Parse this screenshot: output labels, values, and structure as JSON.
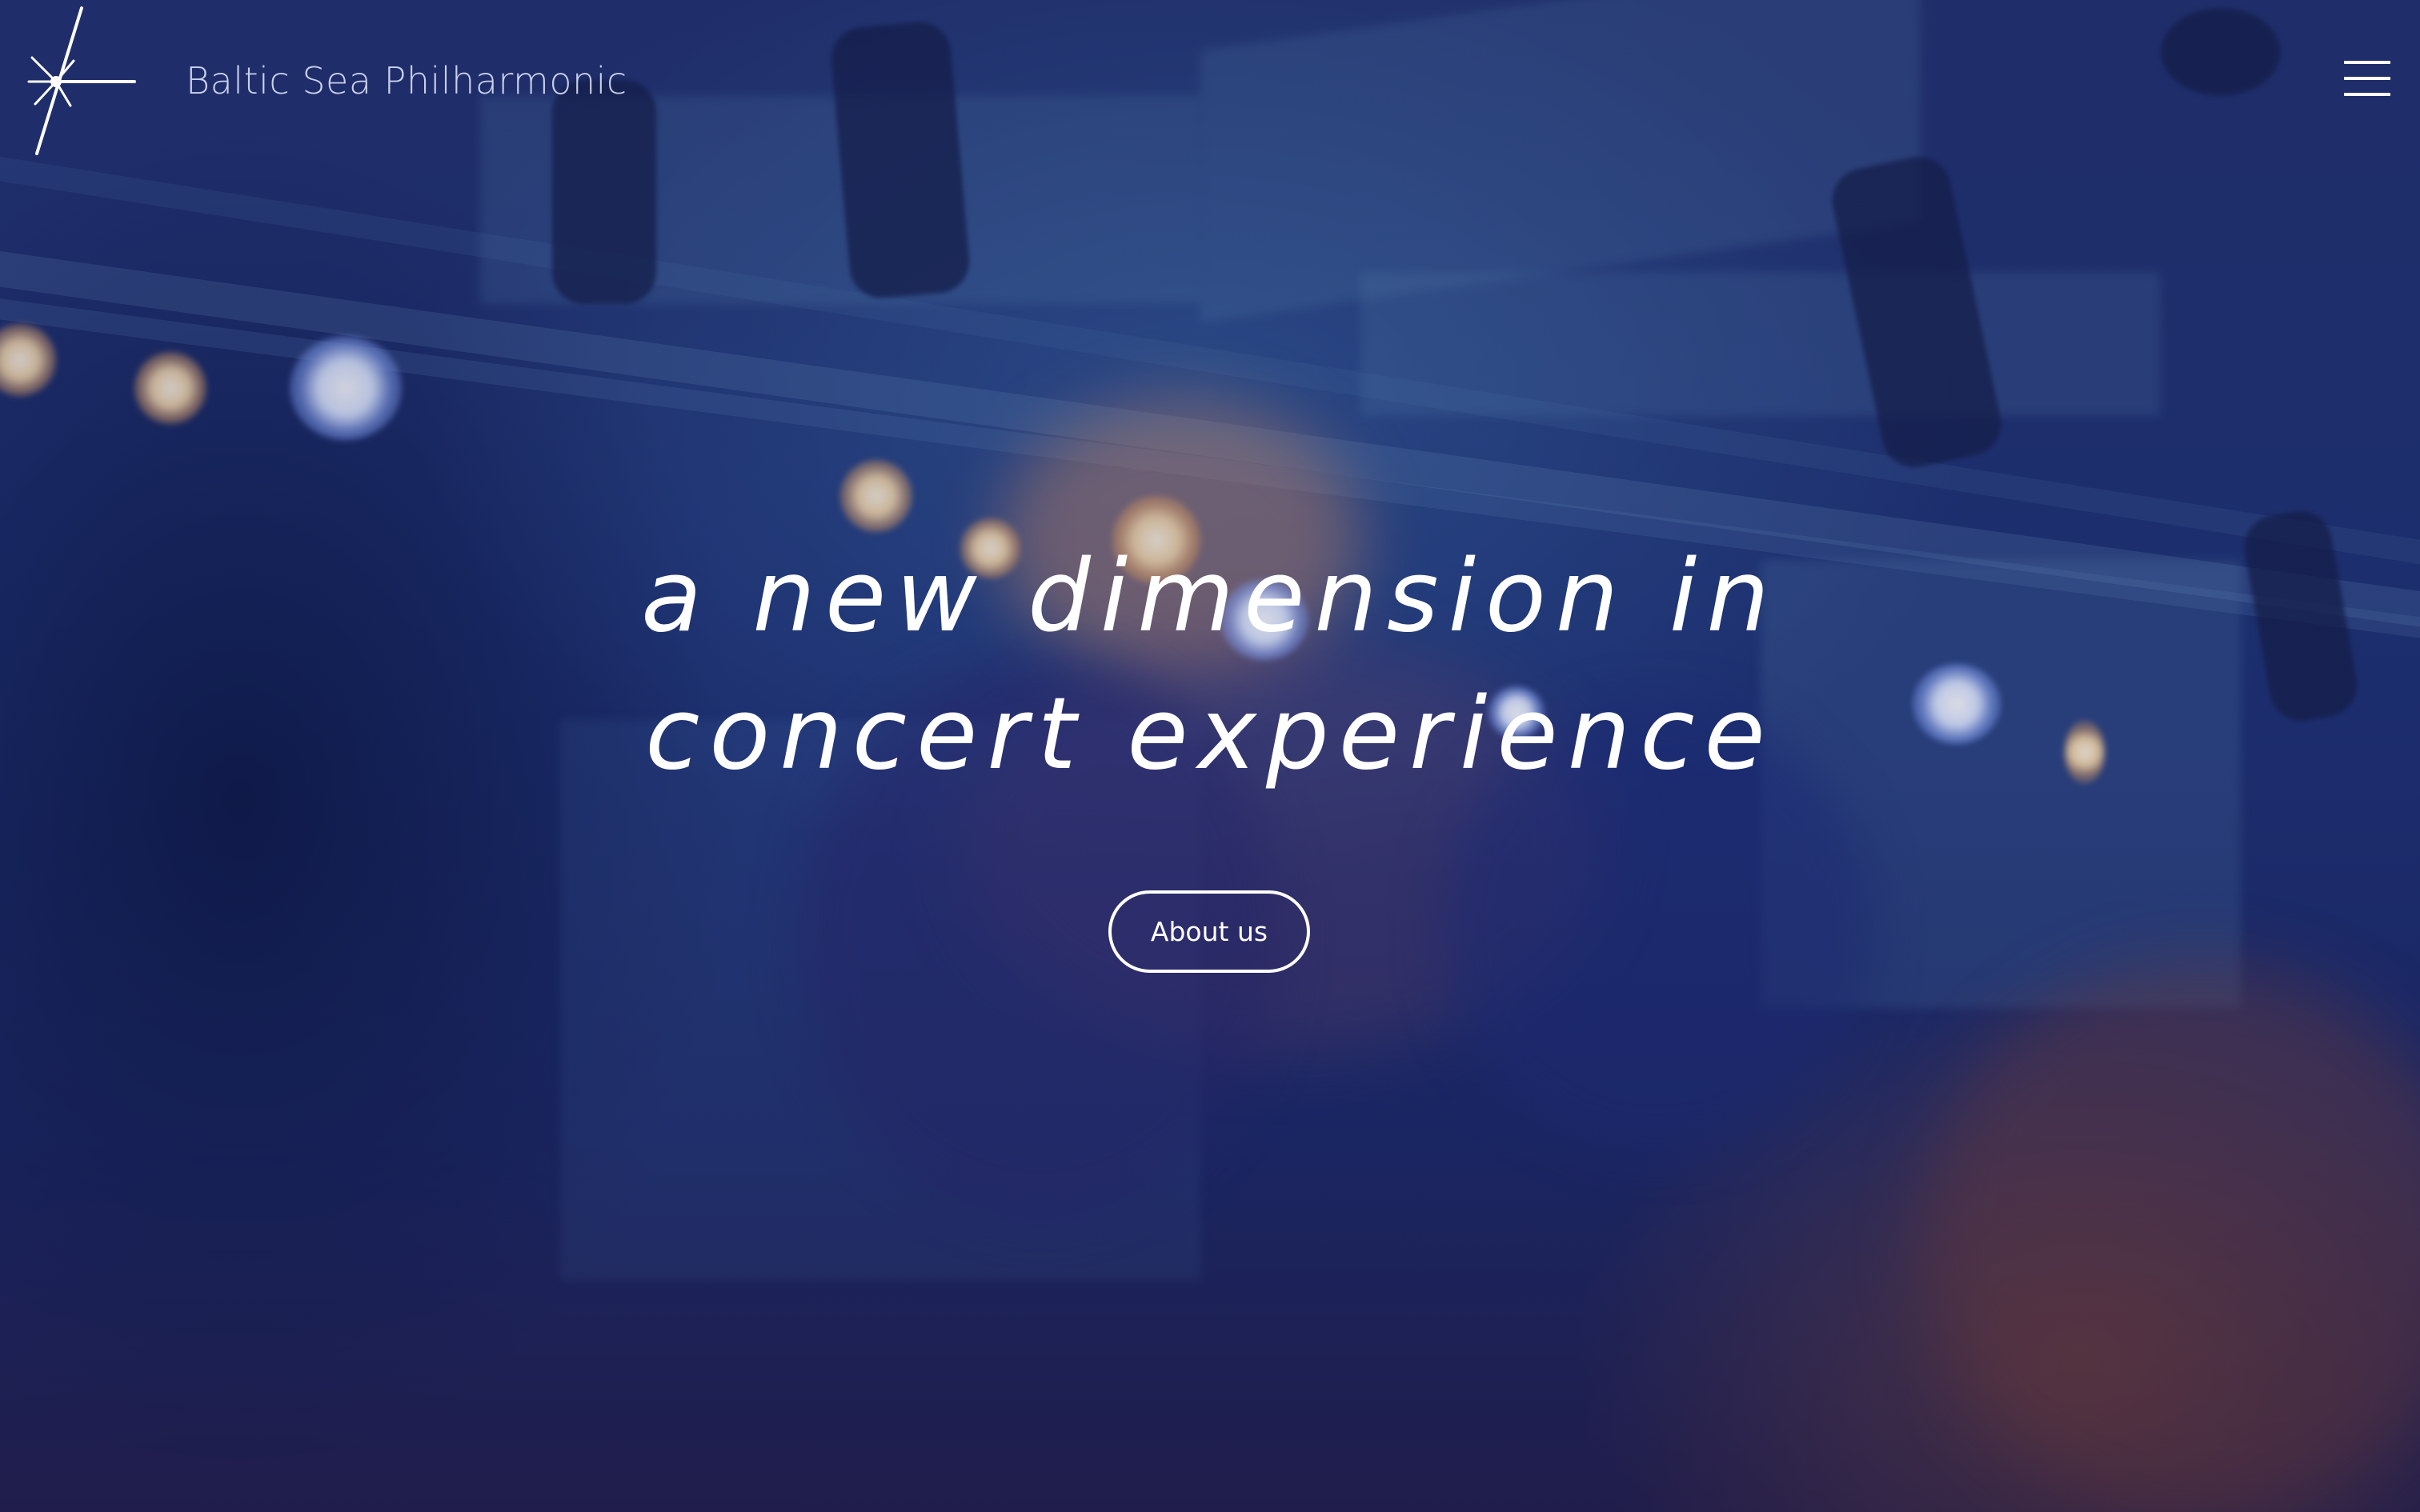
{
  "header": {
    "brand_name": "Baltic Sea Philharmonic",
    "logo_icon": "starburst-logo-icon",
    "menu_icon": "hamburger-menu-icon"
  },
  "hero": {
    "headline_lines": [
      "a new dimension in",
      "concert experience"
    ],
    "cta_label": "About us",
    "background": "concert-stage-lights-photo"
  },
  "colors": {
    "background_blue": "#1e3172",
    "text": "#ffffff",
    "warm_light": "#f4d7a8"
  }
}
